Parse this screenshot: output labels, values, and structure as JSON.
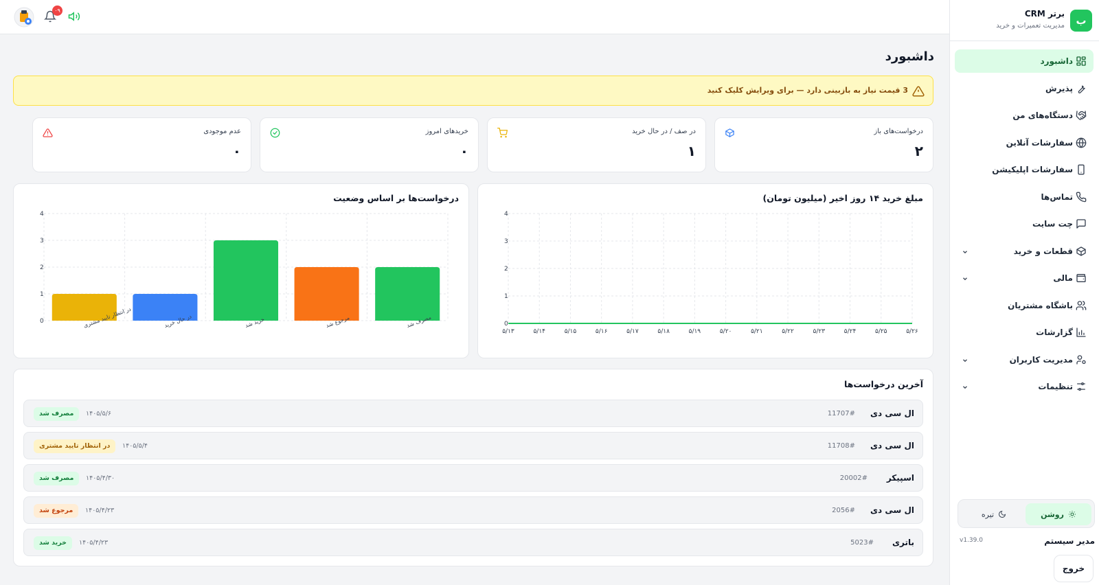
{
  "brand": {
    "logo_letter": "ب",
    "title": "برتر CRM",
    "subtitle": "مدیریت تعمیرات و خرید"
  },
  "nav": [
    {
      "label": "داشبورد",
      "icon": "dashboard-grid-icon",
      "active": true,
      "chevron": false
    },
    {
      "label": "پذیرش",
      "icon": "wrench-icon",
      "active": false,
      "chevron": false
    },
    {
      "label": "دستگاه‌های من",
      "icon": "handshake-icon",
      "active": false,
      "chevron": false
    },
    {
      "label": "سفارشات آنلاین",
      "icon": "globe-icon",
      "active": false,
      "chevron": false
    },
    {
      "label": "سفارشات اپلیکیشن",
      "icon": "smartphone-icon",
      "active": false,
      "chevron": false
    },
    {
      "label": "تماس‌ها",
      "icon": "phone-icon",
      "active": false,
      "chevron": false
    },
    {
      "label": "چت سایت",
      "icon": "chat-icon",
      "active": false,
      "chevron": false
    },
    {
      "label": "قطعات و خرید",
      "icon": "package-icon",
      "active": false,
      "chevron": true
    },
    {
      "label": "مالی",
      "icon": "wallet-icon",
      "active": false,
      "chevron": true
    },
    {
      "label": "باشگاه مشتریان",
      "icon": "users-icon",
      "active": false,
      "chevron": false
    },
    {
      "label": "گزارشات",
      "icon": "bar-chart-icon",
      "active": false,
      "chevron": false
    },
    {
      "label": "مدیریت کاربران",
      "icon": "user-cog-icon",
      "active": false,
      "chevron": true
    },
    {
      "label": "تنظیمات",
      "icon": "sliders-icon",
      "active": false,
      "chevron": true
    }
  ],
  "theme": {
    "light_label": "روشن",
    "dark_label": "تیره"
  },
  "user": {
    "name": "مدیر سیستم",
    "version": "v1.39.0",
    "logout_label": "خروج"
  },
  "topbar": {
    "notification_count": "۰۹"
  },
  "page": {
    "title": "داشبورد"
  },
  "alert": {
    "text": "3 قیمت نیاز به بازبینی دارد — برای ویرایش کلیک کنید"
  },
  "stats": [
    {
      "label": "درخواست‌های باز",
      "value": "۲",
      "icon": "box-icon",
      "color": "#3b82f6"
    },
    {
      "label": "در صف / در حال خرید",
      "value": "۱",
      "icon": "cart-icon",
      "color": "#eab308"
    },
    {
      "label": "خریدهای امروز",
      "value": "۰",
      "icon": "check-circle-icon",
      "color": "#22c55e"
    },
    {
      "label": "عدم موجودی",
      "value": "۰",
      "icon": "warning-icon",
      "color": "#ef4444"
    }
  ],
  "chart_data": [
    {
      "type": "line",
      "title": "مبلغ خرید ۱۴ روز اخیر (میلیون تومان)",
      "x": [
        "۵/۱۳",
        "۵/۱۴",
        "۵/۱۵",
        "۵/۱۶",
        "۵/۱۷",
        "۵/۱۸",
        "۵/۱۹",
        "۵/۲۰",
        "۵/۲۱",
        "۵/۲۲",
        "۵/۲۳",
        "۵/۲۴",
        "۵/۲۵",
        "۵/۲۶"
      ],
      "y": [
        0,
        0,
        0,
        0,
        0,
        0,
        0,
        0,
        0,
        0,
        0,
        0,
        0,
        0
      ],
      "ylim": [
        0,
        4
      ],
      "yticks": [
        "0",
        "1",
        "2",
        "3",
        "4"
      ],
      "grid": true,
      "color": "#22c55e"
    },
    {
      "type": "bar",
      "title": "درخواست‌ها بر اساس وضعیت",
      "categories": [
        "در انتظار تایید مشتری",
        "در حال خرید",
        "خرید شد",
        "مرجوع شد",
        "مصرف شد"
      ],
      "values": [
        1,
        1,
        3,
        2,
        2
      ],
      "colors": [
        "#eab308",
        "#3b82f6",
        "#22c55e",
        "#f97316",
        "#22c55e"
      ],
      "ylim": [
        0,
        4
      ],
      "yticks": [
        "0",
        "1",
        "2",
        "3",
        "4"
      ],
      "grid": true
    }
  ],
  "recent": {
    "title": "آخرین درخواست‌ها",
    "rows": [
      {
        "name": "ال سی دی",
        "id": "11707#",
        "date": "۱۴۰۵/۵/۶",
        "status": "مصرف شد",
        "status_kind": "green"
      },
      {
        "name": "ال سی دی",
        "id": "11708#",
        "date": "۱۴۰۵/۵/۴",
        "status": "در انتظار تایید مشتری",
        "status_kind": "yellow"
      },
      {
        "name": "اسپیکر",
        "id": "20002#",
        "date": "۱۴۰۵/۴/۳۰",
        "status": "مصرف شد",
        "status_kind": "green"
      },
      {
        "name": "ال سی دی",
        "id": "2056#",
        "date": "۱۴۰۵/۴/۲۳",
        "status": "مرجوع شد",
        "status_kind": "orange"
      },
      {
        "name": "باتری",
        "id": "5023#",
        "date": "۱۴۰۵/۴/۲۳",
        "status": "خرید شد",
        "status_kind": "green"
      }
    ]
  }
}
